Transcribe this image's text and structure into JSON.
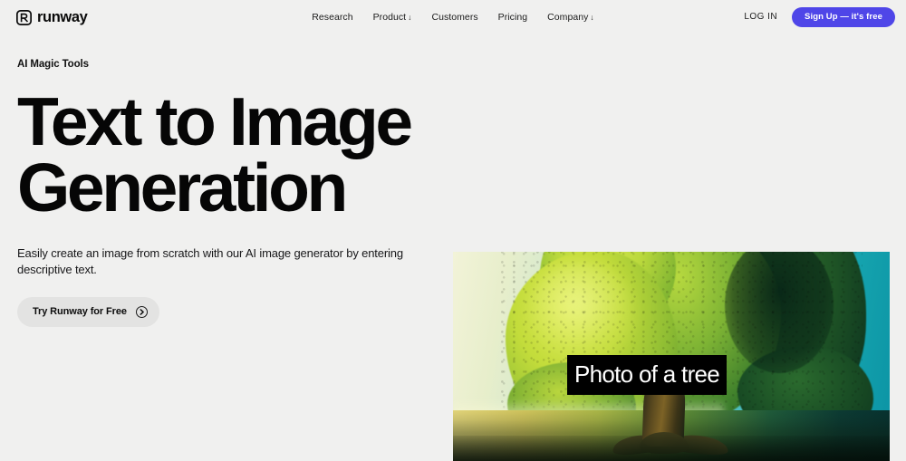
{
  "header": {
    "brand": {
      "name": "runway",
      "logo_icon": "runway-mark-icon"
    },
    "nav": [
      {
        "label": "Research",
        "caret": ""
      },
      {
        "label": "Product",
        "caret": "↓"
      },
      {
        "label": "Customers",
        "caret": ""
      },
      {
        "label": "Pricing",
        "caret": ""
      },
      {
        "label": "Company",
        "caret": "↓"
      }
    ],
    "login_label": "LOG IN",
    "signup_label": "Sign Up — it's free",
    "signup_color": "#4f46e8"
  },
  "hero": {
    "eyebrow": "AI Magic Tools",
    "headline": "Text to Image Generation",
    "subcopy": "Easily create an image from scratch with our AI image generator by entering descriptive text.",
    "cta_label": "Try Runway for Free",
    "cta_icon": "chevron-right-icon",
    "cta_bg": "#e3e3e2"
  },
  "media": {
    "alt": "AI generated photo of a large tree in a field",
    "caption": "Photo of a tree",
    "caption_bg": "#000000",
    "caption_color": "#ffffff"
  },
  "theme": {
    "background": "#f0f0ef",
    "text": "#0a0a0a",
    "accent": "#4f46e8"
  }
}
